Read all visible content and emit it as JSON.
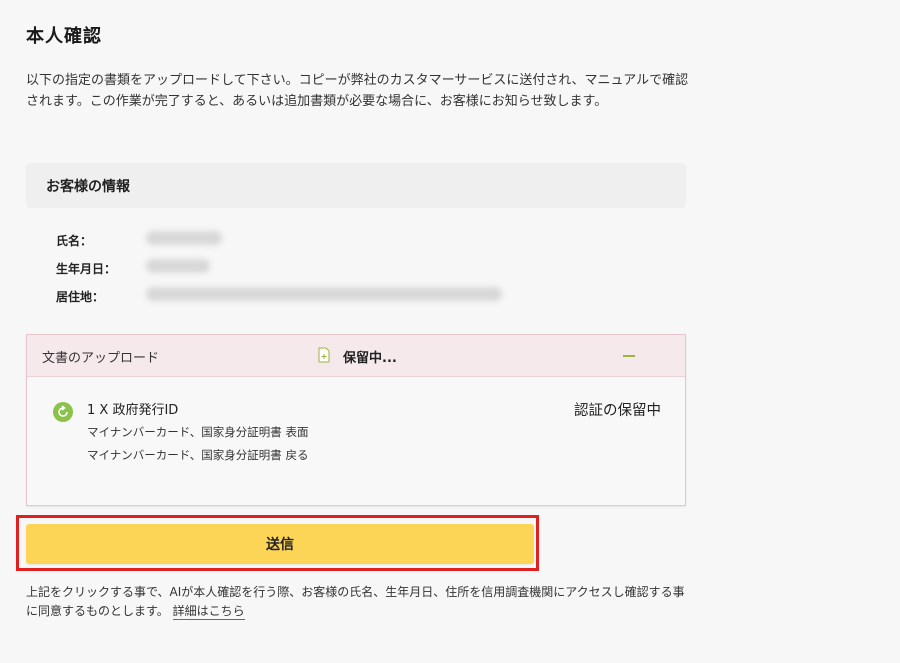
{
  "page": {
    "title": "本人確認",
    "intro": "以下の指定の書類をアップロードして下さい。コピーが弊社のカスタマーサービスに送付され、マニュアルで確認されます。この作業が完了すると、あるいは追加書類が必要な場合に、お客様にお知らせ致します。"
  },
  "customer_info": {
    "header": "お客様の情報",
    "fields": [
      {
        "label": "氏名："
      },
      {
        "label": "生年月日："
      },
      {
        "label": "居住地："
      }
    ]
  },
  "upload": {
    "header_label": "文書のアップロード",
    "header_status": "保留中...",
    "doc_icon": "document-plus-icon",
    "collapse_icon": "minus-icon",
    "item": {
      "icon": "refresh-icon",
      "title": "1 X 政府発行ID",
      "lines": [
        "マイナンバーカード、国家身分証明書 表面",
        "マイナンバーカード、国家身分証明書 戻る"
      ],
      "status": "認証の保留中"
    }
  },
  "submit": {
    "label": "送信"
  },
  "consent": {
    "text": "上記をクリックする事で、AIが本人確認を行う際、お客様の氏名、生年月日、住所を信用調査機関にアクセスし確認する事に同意するものとします。",
    "link": "詳細はこちら"
  },
  "colors": {
    "button": "#fdd556",
    "highlight_border": "#e02020",
    "upload_header_bg": "#f6e9ec",
    "status_icon": "#8bc34a"
  }
}
